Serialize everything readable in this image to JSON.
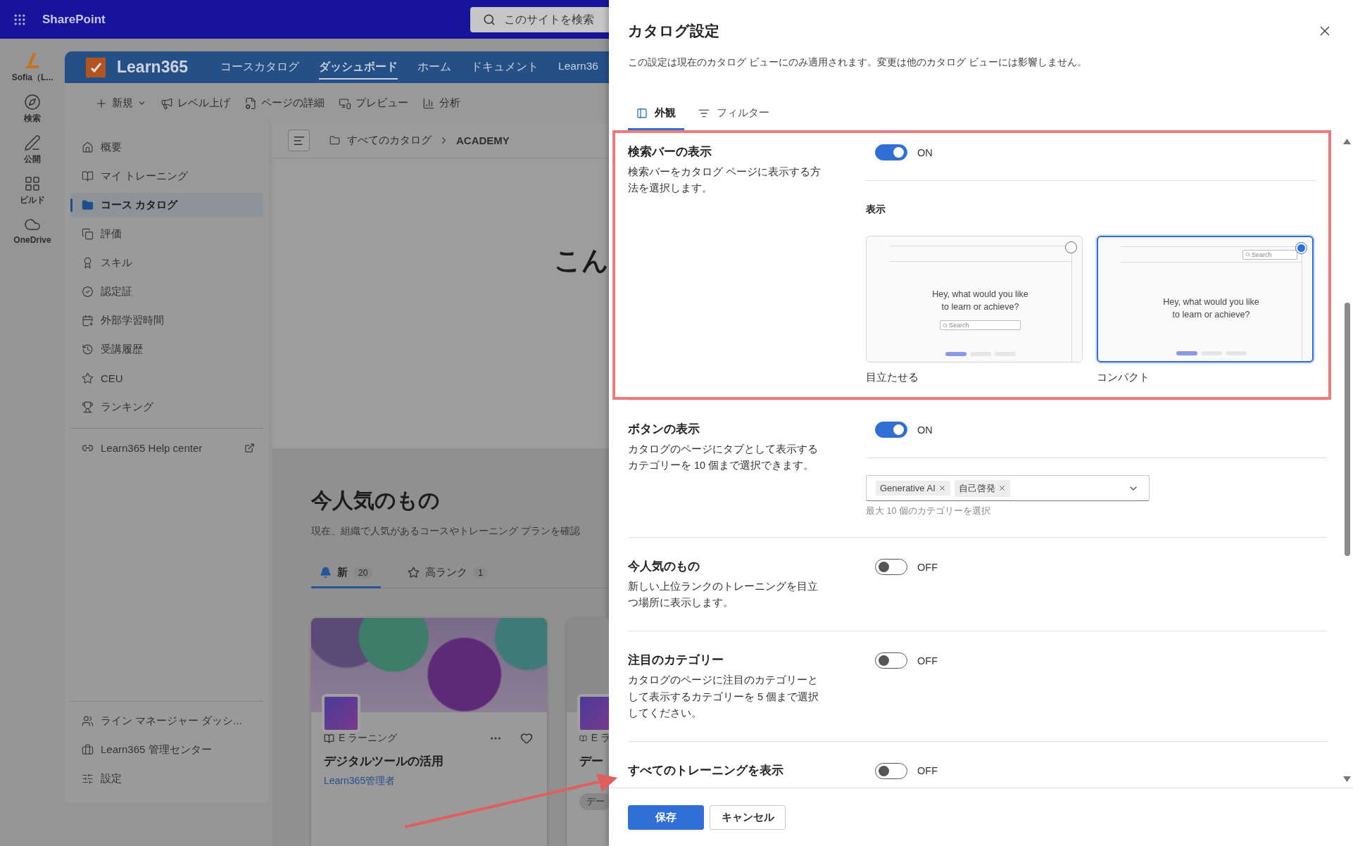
{
  "suite_bar": {
    "app_name": "SharePoint",
    "search": {
      "placeholder": "このサイトを検索"
    }
  },
  "app_rail": [
    {
      "label": "Sofia（L..."
    },
    {
      "label": "検索"
    },
    {
      "label": "公開"
    },
    {
      "label": "ビルド"
    },
    {
      "label": "OneDrive"
    }
  ],
  "site_header": {
    "title": "Learn365",
    "nav": [
      {
        "label": "コースカタログ",
        "selected": false
      },
      {
        "label": "ダッシュボード",
        "selected": true
      },
      {
        "label": "ホーム",
        "selected": false
      },
      {
        "label": "ドキュメント",
        "selected": false
      },
      {
        "label": "Learn36",
        "selected": false
      }
    ]
  },
  "command_bar": [
    {
      "label": "新規",
      "kind": "dropdown"
    },
    {
      "label": "レベル上げ",
      "kind": "action"
    },
    {
      "label": "ページの詳細",
      "kind": "action"
    },
    {
      "label": "プレビュー",
      "kind": "action"
    },
    {
      "label": "分析",
      "kind": "action"
    }
  ],
  "side_nav": {
    "items": [
      {
        "label": "概要",
        "selected": false
      },
      {
        "label": "マイ トレーニング",
        "selected": false
      },
      {
        "label": "コース カタログ",
        "selected": true
      },
      {
        "label": "評価",
        "selected": false
      },
      {
        "label": "スキル",
        "selected": false
      },
      {
        "label": "認定証",
        "selected": false
      },
      {
        "label": "外部学習時間",
        "selected": false
      },
      {
        "label": "受講履歴",
        "selected": false
      },
      {
        "label": "CEU",
        "selected": false
      },
      {
        "label": "ランキング",
        "selected": false
      }
    ],
    "help_link": "Learn365 Help center",
    "footer_items": [
      {
        "label": "ライン マネージャー ダッシ..."
      },
      {
        "label": "Learn365 管理センター"
      },
      {
        "label": "設定"
      }
    ]
  },
  "breadcrumb": [
    "すべてのカタログ",
    "ACADEMY"
  ],
  "hero_heading": "こん",
  "popular": {
    "title": "今人気のもの",
    "description": "現在、組織で人気があるコースやトレーニング プランを確認",
    "tabs": [
      {
        "label": "新",
        "count": "20",
        "selected": true
      },
      {
        "label": "高ランク",
        "count": "1",
        "selected": false
      }
    ],
    "cards": [
      {
        "type": "E ラーニング",
        "title": "デジタルツールの活用",
        "author": "Learn365管理者"
      },
      {
        "type": "E ラ",
        "title": "デー",
        "tag": "デー"
      }
    ]
  },
  "panel": {
    "title": "カタログ設定",
    "description": "この設定は現在のカタログ ビューにのみ適用されます。変更は他のカタログ ビューには影響しません。",
    "tabs": [
      {
        "label": "外観",
        "selected": true
      },
      {
        "label": "フィルター",
        "selected": false
      }
    ],
    "sections": [
      {
        "kind": "search_bar",
        "highlighted": true,
        "title": "検索バーの表示",
        "description": "検索バーをカタログ ページに表示する方法を選択します。",
        "on": true,
        "state_label": "ON",
        "display_label": "表示",
        "options": [
          {
            "kind": "prominent",
            "label": "目立たせる",
            "selected": false,
            "preview_text": "Hey, what would you like\nto learn or achieve?",
            "search_placeholder": "Search"
          },
          {
            "kind": "compact",
            "label": "コンパクト",
            "selected": true,
            "preview_text": "Hey, what would you like\nto learn or achieve?",
            "search_placeholder": "Search"
          }
        ]
      },
      {
        "kind": "categories",
        "highlighted": false,
        "title": "ボタンの表示",
        "description": "カタログのページにタブとして表示するカテゴリーを 10 個まで選択できます。",
        "on": true,
        "state_label": "ON",
        "chips": [
          "Generative AI",
          "自己啓発"
        ],
        "hint": "最大 10 個のカテゴリーを選択"
      },
      {
        "kind": "toggle",
        "highlighted": false,
        "title": "今人気のもの",
        "description": "新しい上位ランクのトレーニングを目立つ場所に表示します。",
        "on": false,
        "state_label": "OFF"
      },
      {
        "kind": "toggle",
        "highlighted": false,
        "title": "注目のカテゴリー",
        "description": "カタログのページに注目のカテゴリーとして表示するカテゴリーを 5 個まで選択してください。",
        "on": false,
        "state_label": "OFF"
      },
      {
        "kind": "toggle",
        "highlighted": false,
        "title": "すべてのトレーニングを表示",
        "on": false,
        "state_label": "OFF"
      }
    ],
    "buttons": [
      {
        "label": "保存",
        "kind": "primary"
      },
      {
        "label": "キャンセル",
        "kind": "secondary"
      }
    ]
  },
  "annotations": [
    {
      "kind": "arrow"
    }
  ]
}
